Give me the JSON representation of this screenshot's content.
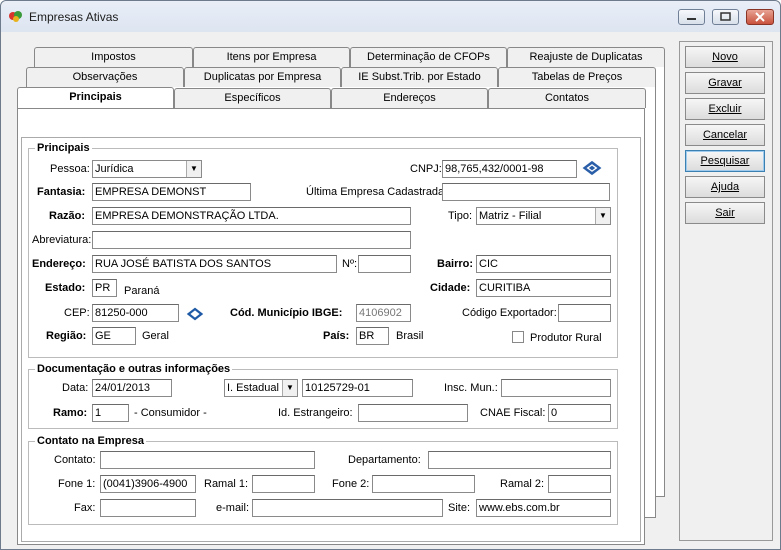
{
  "window": {
    "title": "Empresas Ativas"
  },
  "tabs": {
    "row1": [
      "Impostos",
      "Itens por Empresa",
      "Determinação de CFOPs",
      "Reajuste de Duplicatas"
    ],
    "row2": [
      "Observações",
      "Duplicatas por Empresa",
      "IE Subst.Trib. por Estado",
      "Tabelas de Preços"
    ],
    "row3": [
      "Principais",
      "Específicos",
      "Endereços",
      "Contatos"
    ]
  },
  "buttons": {
    "novo": "Novo",
    "gravar": "Gravar",
    "excluir": "Excluir",
    "cancelar": "Cancelar",
    "pesquisar": "Pesquisar",
    "ajuda": "Ajuda",
    "sair": "Sair"
  },
  "principais": {
    "group_title": "Principais",
    "pessoa_label": "Pessoa:",
    "pessoa_value": "Jurídica",
    "cnpj_label": "CNPJ:",
    "cnpj_value": "98,765,432/0001-98",
    "fantasia_label": "Fantasia:",
    "fantasia_value": "EMPRESA DEMONST",
    "ultima_label": "Última Empresa Cadastrada:",
    "ultima_value": "",
    "razao_label": "Razão:",
    "razao_value": "EMPRESA DEMONSTRAÇÃO LTDA.",
    "tipo_label": "Tipo:",
    "tipo_value": "Matriz - Filial",
    "abrev_label": "Abreviatura:",
    "abrev_value": "",
    "endereco_label": "Endereço:",
    "endereco_value": "RUA JOSÉ BATISTA DOS SANTOS",
    "numero_label": "Nº:",
    "numero_value": "",
    "bairro_label": "Bairro:",
    "bairro_value": "CIC",
    "estado_label": "Estado:",
    "estado_value": "PR",
    "estado_name": "Paraná",
    "cidade_label": "Cidade:",
    "cidade_value": "CURITIBA",
    "cep_label": "CEP:",
    "cep_value": "81250-000",
    "ibge_label": "Cód. Município IBGE:",
    "ibge_value": "4106902",
    "exportador_label": "Código Exportador:",
    "exportador_value": "",
    "regiao_label": "Região:",
    "regiao_value": "GE",
    "regiao_name": "Geral",
    "pais_label": "País:",
    "pais_value": "BR",
    "pais_name": "Brasil",
    "produtor_label": "Produtor Rural"
  },
  "documentacao": {
    "group_title": "Documentação e outras informações",
    "data_label": "Data:",
    "data_value": "24/01/2013",
    "ie_select": "I. Estadual",
    "ie_value": "10125729-01",
    "mun_label": "Insc. Mun.:",
    "mun_value": "",
    "ramo_label": "Ramo:",
    "ramo_value": "1",
    "ramo_name": "- Consumidor -",
    "estrangeiro_label": "Id. Estrangeiro:",
    "estrangeiro_value": "",
    "cnae_label": "CNAE Fiscal:",
    "cnae_value": "0"
  },
  "contato": {
    "group_title": "Contato na Empresa",
    "contato_label": "Contato:",
    "contato_value": "",
    "depto_label": "Departamento:",
    "depto_value": "",
    "fone1_label": "Fone 1:",
    "fone1_value": "(0041)3906-4900",
    "ramal1_label": "Ramal 1:",
    "ramal1_value": "",
    "fone2_label": "Fone 2:",
    "fone2_value": "",
    "ramal2_label": "Ramal 2:",
    "ramal2_value": "",
    "fax_label": "Fax:",
    "fax_value": "",
    "email_label": "e-mail:",
    "email_value": "",
    "site_label": "Site:",
    "site_value": "www.ebs.com.br"
  }
}
